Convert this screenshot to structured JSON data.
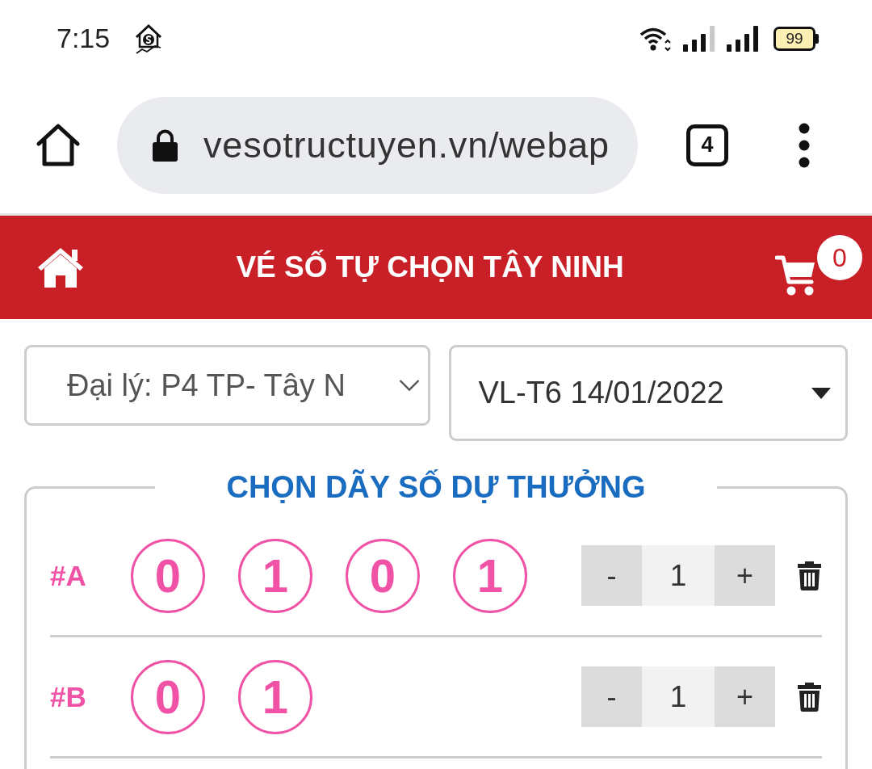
{
  "status_bar": {
    "time": "7:15",
    "battery": "99"
  },
  "browser": {
    "url": "vesotructuyen.vn/webap",
    "tab_count": "4"
  },
  "header": {
    "title": "VÉ SỐ TỰ CHỌN TÂY NINH",
    "cart_count": "0"
  },
  "selects": [
    {
      "kind": "chevron",
      "value": "Đại lý: P4 TP- Tây N"
    },
    {
      "kind": "triangle",
      "value": "VL-T6 14/01/2022"
    }
  ],
  "picker": {
    "title": "CHỌN DÃY SỐ DỰ THƯỞNG",
    "rows": [
      {
        "label": "#A",
        "digits": [
          "0",
          "1",
          "0",
          "1"
        ],
        "minus": "-",
        "quantity": "1",
        "plus": "+"
      },
      {
        "label": "#B",
        "digits": [
          "0",
          "1"
        ],
        "minus": "-",
        "quantity": "1",
        "plus": "+"
      }
    ]
  }
}
